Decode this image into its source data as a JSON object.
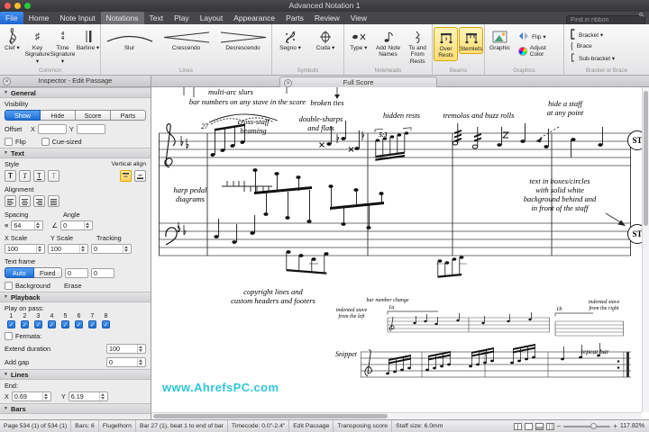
{
  "icons": {
    "disclosure": "▼",
    "check": "✓",
    "close": "✕",
    "minus": "−",
    "plus": "+",
    "sharp": "♯",
    "time_sig": "4\n4",
    "t": "T",
    "spacing": "≡",
    "angle": "∠",
    "brace": "{"
  },
  "titlebar": {
    "title": "Advanced Notation 1"
  },
  "tabs": {
    "items": [
      "File",
      "Home",
      "Note Input",
      "Notations",
      "Text",
      "Play",
      "Layout",
      "Appearance",
      "Parts",
      "Review",
      "View"
    ],
    "find_placeholder": "Find in ribbon"
  },
  "ribbon": {
    "common": {
      "label": "Common",
      "clef": "Clef ▾",
      "key": "Key\nSignature ▾",
      "time": "Time\nSignature ▾",
      "barline": "Barline ▾"
    },
    "lines": {
      "label": "Lines",
      "slur": "Slur",
      "crescendo": "Crescendo",
      "decrescendo": "Decrescendo"
    },
    "symbols": {
      "label": "Symbols",
      "segno": "Segno ▾",
      "coda": "Coda ▾"
    },
    "noteheads": {
      "label": "Noteheads",
      "type": "Type ▾",
      "add_note_names": "Add Note\nNames",
      "to_from_rests": "To and\nFrom Rests"
    },
    "beams": {
      "label": "Beams",
      "over_rests": "Over\nRests",
      "stemlets": "Stemlets"
    },
    "graphics": {
      "label": "Graphics",
      "graphic": "Graphic",
      "flip": "Flip ▾",
      "adjust_color": "Adjust Color"
    },
    "bracket": {
      "label": "Bracket or Brace",
      "bracket": "Bracket ▾",
      "brace": "Brace",
      "sub_bracket": "Sub-bracket ▾"
    }
  },
  "panels": {
    "inspector_title": "Inspector - Edit Passage",
    "score_tab": "Full Score"
  },
  "inspector": {
    "general": {
      "title": "General",
      "visibility_label": "Visibility",
      "show": "Show",
      "hide": "Hide",
      "score": "Score",
      "parts": "Parts",
      "offset_label": "Offset",
      "x_label": "X",
      "y_label": "Y",
      "flip_label": "Flip",
      "cue_label": "Cue-sized"
    },
    "text": {
      "title": "Text",
      "style_label": "Style",
      "vertical_align_label": "Vertical align",
      "alignment_label": "Alignment",
      "spacing_label": "Spacing",
      "angle_label": "Angle",
      "spacing_value": "64",
      "angle_value": "0",
      "x_scale_label": "X Scale",
      "y_scale_label": "Y Scale",
      "tracking_label": "Tracking",
      "x_scale": "100",
      "y_scale": "100",
      "tracking": "0",
      "text_frame_label": "Text frame",
      "auto": "Auto",
      "fixed": "Fixed",
      "frame_w": "0",
      "frame_h": "0",
      "background_label": "Background",
      "erase_label": "Erase"
    },
    "playback": {
      "title": "Playback",
      "play_on_pass_label": "Play on pass:",
      "passes": [
        "1",
        "2",
        "3",
        "4",
        "5",
        "6",
        "7",
        "8"
      ],
      "fermata_label": "Fermata:",
      "extend_label": "Extend duration",
      "extend_value": "100",
      "gap_label": "Add gap",
      "gap_value": "0"
    },
    "lines": {
      "title": "Lines",
      "end_label": "End:",
      "x_label": "X",
      "x_value": "0.69",
      "y_label": "Y",
      "y_value": "6.19"
    },
    "bars": {
      "title": "Bars"
    }
  },
  "score": {
    "annotations": {
      "multi_arc": "multi-arc slurs",
      "bar_numbers": "bar numbers on any stave in the score",
      "broken_ties": "broken ties",
      "hidden_rests": "hidden rests",
      "tremolos": "tremolos and buzz rolls",
      "hide_staff": "hide a staff\nat any point",
      "bar_27": "27",
      "cross_staff": "cross-staff\nbeaming",
      "double_sharps": "double-sharps\nand flats",
      "tuplet": "5:3",
      "harp_pedal": "harp pedal\ndiagrams",
      "text_boxes": "text in boxes/circles\nwith solid white\nbackground behind and\nin front of the staff",
      "copyright": "copyright lines and\ncustom headers and footers",
      "bar_number_change": "bar number change",
      "indented_left": "indented stave\nfrom the left",
      "label_1a": "1a",
      "label_1b": "1b",
      "indented_right": "indented stave\nfrom the right",
      "snippet": "Snippet",
      "repeat_bar": "repeat bar",
      "st": "ST"
    },
    "watermark": "www.AhrefsPC.com"
  },
  "status": {
    "page": "Page 534 (1) of 534 (1)",
    "bars": "Bars: 6",
    "instrument": "Flugelhorn",
    "selection": "Bar 27 (1), beat 1 to end of bar",
    "timecode": "Timecode: 0.0\"-2.4\"",
    "mode": "Edit Passage",
    "transposing": "Transposing score",
    "staff_size": "Staff size: 6.0mm",
    "zoom": "117.82%"
  }
}
